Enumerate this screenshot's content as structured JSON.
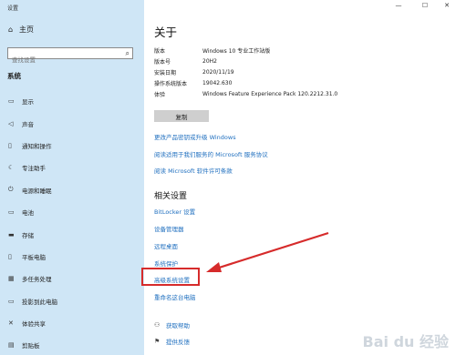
{
  "window": {
    "title": "设置",
    "minimize": "—",
    "maximize": "☐",
    "close": "✕"
  },
  "sidebar": {
    "home_label": "主页",
    "search_placeholder": "查找设置",
    "section_label": "系统",
    "items": [
      {
        "icon": "display-icon",
        "glyph": "▭",
        "label": "显示"
      },
      {
        "icon": "sound-icon",
        "glyph": "◁",
        "label": "声音"
      },
      {
        "icon": "notifications-icon",
        "glyph": "▯",
        "label": "通知和操作"
      },
      {
        "icon": "focus-assist-icon",
        "glyph": "☾",
        "label": "专注助手"
      },
      {
        "icon": "power-sleep-icon",
        "glyph": "⏻",
        "label": "电源和睡眠"
      },
      {
        "icon": "battery-icon",
        "glyph": "▭",
        "label": "电池"
      },
      {
        "icon": "storage-icon",
        "glyph": "▬",
        "label": "存储"
      },
      {
        "icon": "tablet-icon",
        "glyph": "▯",
        "label": "平板电脑"
      },
      {
        "icon": "multitasking-icon",
        "glyph": "▦",
        "label": "多任务处理"
      },
      {
        "icon": "projecting-icon",
        "glyph": "▭",
        "label": "投影到此电脑"
      },
      {
        "icon": "shared-experiences-icon",
        "glyph": "✕",
        "label": "体验共享"
      },
      {
        "icon": "clipboard-icon",
        "glyph": "▤",
        "label": "剪贴板"
      }
    ]
  },
  "main": {
    "title": "关于",
    "specs": [
      {
        "k": "版本",
        "v": "Windows 10 专业工作站版"
      },
      {
        "k": "版本号",
        "v": "20H2"
      },
      {
        "k": "安装日期",
        "v": "2020/11/19"
      },
      {
        "k": "操作系统版本",
        "v": "19042.630"
      },
      {
        "k": "体验",
        "v": "Windows Feature Experience Pack 120.2212.31.0"
      }
    ],
    "copy_label": "复制",
    "links": [
      "更改产品密钥或升级 Windows",
      "阅读适用于我们服务的 Microsoft 服务协议",
      "阅读 Microsoft 软件许可条款"
    ],
    "related_title": "相关设置",
    "related": [
      "BitLocker 设置",
      "设备管理器",
      "远程桌面",
      "系统保护",
      "高级系统设置",
      "重命名这台电脑"
    ],
    "help": [
      {
        "icon": "help-icon",
        "glyph": "⚇",
        "label": "获取帮助"
      },
      {
        "icon": "feedback-icon",
        "glyph": "⚑",
        "label": "提供反馈"
      }
    ]
  },
  "annotation_color": "#d62b2b",
  "watermark": "Bai du 经验"
}
